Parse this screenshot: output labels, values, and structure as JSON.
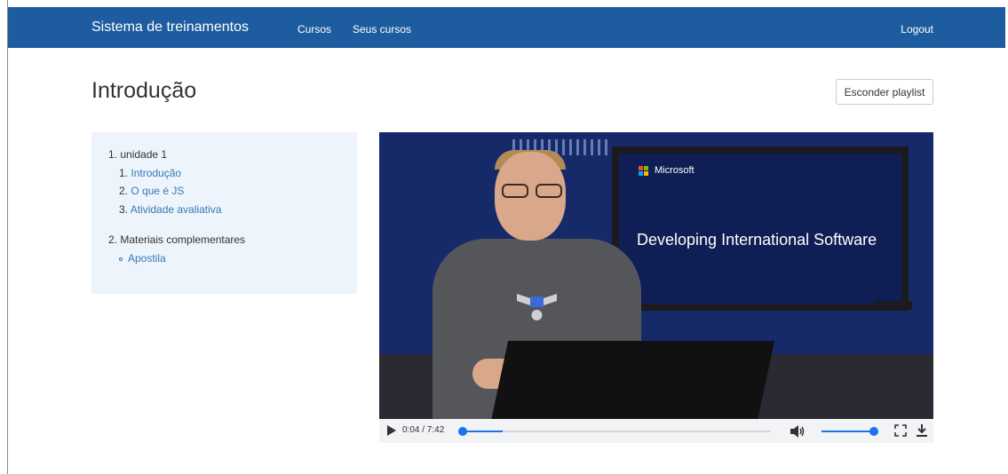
{
  "navbar": {
    "brand": "Sistema de treinamentos",
    "links": [
      {
        "label": "Cursos"
      },
      {
        "label": "Seus cursos"
      }
    ],
    "logout": "Logout",
    "color": "#1d5c9e"
  },
  "page": {
    "title": "Introdução",
    "toggle_playlist": "Esconder playlist"
  },
  "playlist": {
    "units": [
      {
        "label": "1. unidade 1",
        "lessons": [
          {
            "num": "1.",
            "label": "Introdução"
          },
          {
            "num": "2.",
            "label": "O que é JS"
          },
          {
            "num": "3.",
            "label": "Atividade avaliativa"
          }
        ]
      },
      {
        "label": "2. Materiais complementares",
        "lessons": [
          {
            "label": "Apostila"
          }
        ]
      }
    ]
  },
  "video": {
    "screen_brand": "Microsoft",
    "screen_title": "Developing International Software"
  },
  "player": {
    "time": "0:04 / 7:42",
    "progress": 0.0086,
    "volume": 1.0,
    "accent": "#1a73e8"
  }
}
